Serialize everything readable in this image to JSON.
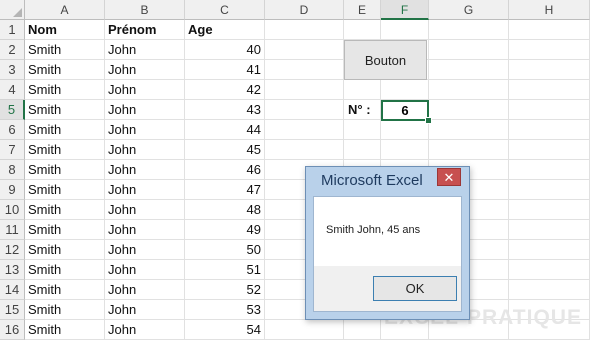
{
  "columns": [
    "A",
    "B",
    "C",
    "D",
    "E",
    "F",
    "G",
    "H"
  ],
  "rows": [
    "1",
    "2",
    "3",
    "4",
    "5",
    "6",
    "7",
    "8",
    "9",
    "10",
    "11",
    "12",
    "13",
    "14",
    "15",
    "16"
  ],
  "headers": {
    "nom": "Nom",
    "prenom": "Prénom",
    "age": "Age"
  },
  "data": [
    {
      "nom": "Smith",
      "prenom": "John",
      "age": "40"
    },
    {
      "nom": "Smith",
      "prenom": "John",
      "age": "41"
    },
    {
      "nom": "Smith",
      "prenom": "John",
      "age": "42"
    },
    {
      "nom": "Smith",
      "prenom": "John",
      "age": "43"
    },
    {
      "nom": "Smith",
      "prenom": "John",
      "age": "44"
    },
    {
      "nom": "Smith",
      "prenom": "John",
      "age": "45"
    },
    {
      "nom": "Smith",
      "prenom": "John",
      "age": "46"
    },
    {
      "nom": "Smith",
      "prenom": "John",
      "age": "47"
    },
    {
      "nom": "Smith",
      "prenom": "John",
      "age": "48"
    },
    {
      "nom": "Smith",
      "prenom": "John",
      "age": "49"
    },
    {
      "nom": "Smith",
      "prenom": "John",
      "age": "50"
    },
    {
      "nom": "Smith",
      "prenom": "John",
      "age": "51"
    },
    {
      "nom": "Smith",
      "prenom": "John",
      "age": "52"
    },
    {
      "nom": "Smith",
      "prenom": "John",
      "age": "53"
    },
    {
      "nom": "Smith",
      "prenom": "John",
      "age": "54"
    }
  ],
  "selected_column": "F",
  "selected_row": "5",
  "button_label": "Bouton",
  "number_label": "N° :",
  "number_value": "6",
  "dialog": {
    "title": "Microsoft Excel",
    "close": "✕",
    "message": "Smith John, 45 ans",
    "ok_label": "OK"
  },
  "watermark": "EXCEL-PRATIQUE"
}
